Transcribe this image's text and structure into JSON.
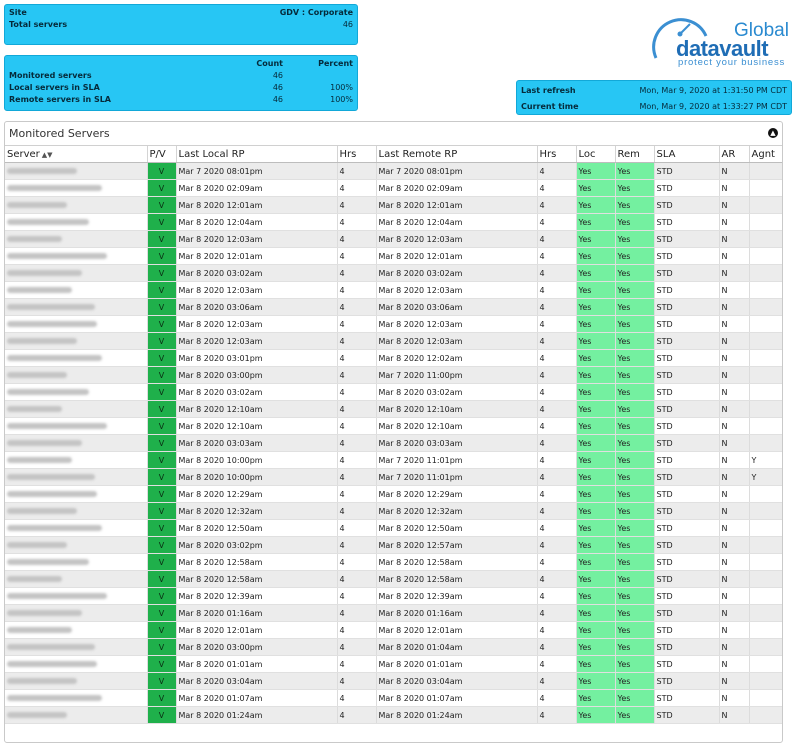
{
  "site_panel": {
    "site_label": "Site",
    "site_value": "GDV : Corporate",
    "total_label": "Total servers",
    "total_value": "46"
  },
  "count_panel": {
    "headers": [
      "",
      "Count",
      "Percent"
    ],
    "rows": [
      {
        "label": "Monitored servers",
        "count": "46",
        "percent": ""
      },
      {
        "label": "Local servers in SLA",
        "count": "46",
        "percent": "100%"
      },
      {
        "label": "Remote servers in SLA",
        "count": "46",
        "percent": "100%"
      }
    ]
  },
  "refresh_panel": {
    "last_refresh_label": "Last refresh",
    "last_refresh_value": "Mon, Mar 9, 2020 at 1:31:50 PM CDT",
    "current_time_label": "Current time",
    "current_time_value": "Mon, Mar 9, 2020 at 1:33:27 PM CDT"
  },
  "logo": {
    "line1": "Global",
    "line2": "datavault",
    "tagline": "protect your business",
    "colors": {
      "primary": "#1f6db5",
      "accent": "#2a8ad0"
    }
  },
  "monitored": {
    "title": "Monitored Servers",
    "columns": [
      "Server",
      "P/V",
      "Last Local RP",
      "Hrs",
      "Last Remote RP",
      "Hrs",
      "Loc",
      "Rem",
      "SLA",
      "AR",
      "Agnt"
    ],
    "rows": [
      {
        "pv": "V",
        "local": "Mar  7 2020 08:01pm",
        "lh": "4",
        "remote": "Mar  7 2020 08:01pm",
        "rh": "4",
        "loc": "Yes",
        "rem": "Yes",
        "sla": "STD",
        "ar": "N",
        "agnt": ""
      },
      {
        "pv": "V",
        "local": "Mar  8 2020 02:09am",
        "lh": "4",
        "remote": "Mar  8 2020 02:09am",
        "rh": "4",
        "loc": "Yes",
        "rem": "Yes",
        "sla": "STD",
        "ar": "N",
        "agnt": ""
      },
      {
        "pv": "V",
        "local": "Mar  8 2020 12:01am",
        "lh": "4",
        "remote": "Mar  8 2020 12:01am",
        "rh": "4",
        "loc": "Yes",
        "rem": "Yes",
        "sla": "STD",
        "ar": "N",
        "agnt": ""
      },
      {
        "pv": "V",
        "local": "Mar  8 2020 12:04am",
        "lh": "4",
        "remote": "Mar  8 2020 12:04am",
        "rh": "4",
        "loc": "Yes",
        "rem": "Yes",
        "sla": "STD",
        "ar": "N",
        "agnt": ""
      },
      {
        "pv": "V",
        "local": "Mar  8 2020 12:03am",
        "lh": "4",
        "remote": "Mar  8 2020 12:03am",
        "rh": "4",
        "loc": "Yes",
        "rem": "Yes",
        "sla": "STD",
        "ar": "N",
        "agnt": ""
      },
      {
        "pv": "V",
        "local": "Mar  8 2020 12:01am",
        "lh": "4",
        "remote": "Mar  8 2020 12:01am",
        "rh": "4",
        "loc": "Yes",
        "rem": "Yes",
        "sla": "STD",
        "ar": "N",
        "agnt": ""
      },
      {
        "pv": "V",
        "local": "Mar  8 2020 03:02am",
        "lh": "4",
        "remote": "Mar  8 2020 03:02am",
        "rh": "4",
        "loc": "Yes",
        "rem": "Yes",
        "sla": "STD",
        "ar": "N",
        "agnt": ""
      },
      {
        "pv": "V",
        "local": "Mar  8 2020 12:03am",
        "lh": "4",
        "remote": "Mar  8 2020 12:03am",
        "rh": "4",
        "loc": "Yes",
        "rem": "Yes",
        "sla": "STD",
        "ar": "N",
        "agnt": ""
      },
      {
        "pv": "V",
        "local": "Mar  8 2020 03:06am",
        "lh": "4",
        "remote": "Mar  8 2020 03:06am",
        "rh": "4",
        "loc": "Yes",
        "rem": "Yes",
        "sla": "STD",
        "ar": "N",
        "agnt": ""
      },
      {
        "pv": "V",
        "local": "Mar  8 2020 12:03am",
        "lh": "4",
        "remote": "Mar  8 2020 12:03am",
        "rh": "4",
        "loc": "Yes",
        "rem": "Yes",
        "sla": "STD",
        "ar": "N",
        "agnt": ""
      },
      {
        "pv": "V",
        "local": "Mar  8 2020 12:03am",
        "lh": "4",
        "remote": "Mar  8 2020 12:03am",
        "rh": "4",
        "loc": "Yes",
        "rem": "Yes",
        "sla": "STD",
        "ar": "N",
        "agnt": ""
      },
      {
        "pv": "V",
        "local": "Mar  8 2020 03:01pm",
        "lh": "4",
        "remote": "Mar  8 2020 12:02am",
        "rh": "4",
        "loc": "Yes",
        "rem": "Yes",
        "sla": "STD",
        "ar": "N",
        "agnt": ""
      },
      {
        "pv": "V",
        "local": "Mar  8 2020 03:00pm",
        "lh": "4",
        "remote": "Mar  7 2020 11:00pm",
        "rh": "4",
        "loc": "Yes",
        "rem": "Yes",
        "sla": "STD",
        "ar": "N",
        "agnt": ""
      },
      {
        "pv": "V",
        "local": "Mar  8 2020 03:02am",
        "lh": "4",
        "remote": "Mar  8 2020 03:02am",
        "rh": "4",
        "loc": "Yes",
        "rem": "Yes",
        "sla": "STD",
        "ar": "N",
        "agnt": ""
      },
      {
        "pv": "V",
        "local": "Mar  8 2020 12:10am",
        "lh": "4",
        "remote": "Mar  8 2020 12:10am",
        "rh": "4",
        "loc": "Yes",
        "rem": "Yes",
        "sla": "STD",
        "ar": "N",
        "agnt": ""
      },
      {
        "pv": "V",
        "local": "Mar  8 2020 12:10am",
        "lh": "4",
        "remote": "Mar  8 2020 12:10am",
        "rh": "4",
        "loc": "Yes",
        "rem": "Yes",
        "sla": "STD",
        "ar": "N",
        "agnt": ""
      },
      {
        "pv": "V",
        "local": "Mar  8 2020 03:03am",
        "lh": "4",
        "remote": "Mar  8 2020 03:03am",
        "rh": "4",
        "loc": "Yes",
        "rem": "Yes",
        "sla": "STD",
        "ar": "N",
        "agnt": ""
      },
      {
        "pv": "V",
        "local": "Mar  8 2020 10:00pm",
        "lh": "4",
        "remote": "Mar  7 2020 11:01pm",
        "rh": "4",
        "loc": "Yes",
        "rem": "Yes",
        "sla": "STD",
        "ar": "N",
        "agnt": "Y"
      },
      {
        "pv": "V",
        "local": "Mar  8 2020 10:00pm",
        "lh": "4",
        "remote": "Mar  7 2020 11:01pm",
        "rh": "4",
        "loc": "Yes",
        "rem": "Yes",
        "sla": "STD",
        "ar": "N",
        "agnt": "Y"
      },
      {
        "pv": "V",
        "local": "Mar  8 2020 12:29am",
        "lh": "4",
        "remote": "Mar  8 2020 12:29am",
        "rh": "4",
        "loc": "Yes",
        "rem": "Yes",
        "sla": "STD",
        "ar": "N",
        "agnt": ""
      },
      {
        "pv": "V",
        "local": "Mar  8 2020 12:32am",
        "lh": "4",
        "remote": "Mar  8 2020 12:32am",
        "rh": "4",
        "loc": "Yes",
        "rem": "Yes",
        "sla": "STD",
        "ar": "N",
        "agnt": ""
      },
      {
        "pv": "V",
        "local": "Mar  8 2020 12:50am",
        "lh": "4",
        "remote": "Mar  8 2020 12:50am",
        "rh": "4",
        "loc": "Yes",
        "rem": "Yes",
        "sla": "STD",
        "ar": "N",
        "agnt": ""
      },
      {
        "pv": "V",
        "local": "Mar  8 2020 03:02pm",
        "lh": "4",
        "remote": "Mar  8 2020 12:57am",
        "rh": "4",
        "loc": "Yes",
        "rem": "Yes",
        "sla": "STD",
        "ar": "N",
        "agnt": ""
      },
      {
        "pv": "V",
        "local": "Mar  8 2020 12:58am",
        "lh": "4",
        "remote": "Mar  8 2020 12:58am",
        "rh": "4",
        "loc": "Yes",
        "rem": "Yes",
        "sla": "STD",
        "ar": "N",
        "agnt": ""
      },
      {
        "pv": "V",
        "local": "Mar  8 2020 12:58am",
        "lh": "4",
        "remote": "Mar  8 2020 12:58am",
        "rh": "4",
        "loc": "Yes",
        "rem": "Yes",
        "sla": "STD",
        "ar": "N",
        "agnt": ""
      },
      {
        "pv": "V",
        "local": "Mar  8 2020 12:39am",
        "lh": "4",
        "remote": "Mar  8 2020 12:39am",
        "rh": "4",
        "loc": "Yes",
        "rem": "Yes",
        "sla": "STD",
        "ar": "N",
        "agnt": ""
      },
      {
        "pv": "V",
        "local": "Mar  8 2020 01:16am",
        "lh": "4",
        "remote": "Mar  8 2020 01:16am",
        "rh": "4",
        "loc": "Yes",
        "rem": "Yes",
        "sla": "STD",
        "ar": "N",
        "agnt": ""
      },
      {
        "pv": "V",
        "local": "Mar  8 2020 12:01am",
        "lh": "4",
        "remote": "Mar  8 2020 12:01am",
        "rh": "4",
        "loc": "Yes",
        "rem": "Yes",
        "sla": "STD",
        "ar": "N",
        "agnt": ""
      },
      {
        "pv": "V",
        "local": "Mar  8 2020 03:00pm",
        "lh": "4",
        "remote": "Mar  8 2020 01:04am",
        "rh": "4",
        "loc": "Yes",
        "rem": "Yes",
        "sla": "STD",
        "ar": "N",
        "agnt": ""
      },
      {
        "pv": "V",
        "local": "Mar  8 2020 01:01am",
        "lh": "4",
        "remote": "Mar  8 2020 01:01am",
        "rh": "4",
        "loc": "Yes",
        "rem": "Yes",
        "sla": "STD",
        "ar": "N",
        "agnt": ""
      },
      {
        "pv": "V",
        "local": "Mar  8 2020 03:04am",
        "lh": "4",
        "remote": "Mar  8 2020 03:04am",
        "rh": "4",
        "loc": "Yes",
        "rem": "Yes",
        "sla": "STD",
        "ar": "N",
        "agnt": ""
      },
      {
        "pv": "V",
        "local": "Mar  8 2020 01:07am",
        "lh": "4",
        "remote": "Mar  8 2020 01:07am",
        "rh": "4",
        "loc": "Yes",
        "rem": "Yes",
        "sla": "STD",
        "ar": "N",
        "agnt": ""
      },
      {
        "pv": "V",
        "local": "Mar  8 2020 01:24am",
        "lh": "4",
        "remote": "Mar  8 2020 01:24am",
        "rh": "4",
        "loc": "Yes",
        "rem": "Yes",
        "sla": "STD",
        "ar": "N",
        "agnt": ""
      }
    ]
  }
}
